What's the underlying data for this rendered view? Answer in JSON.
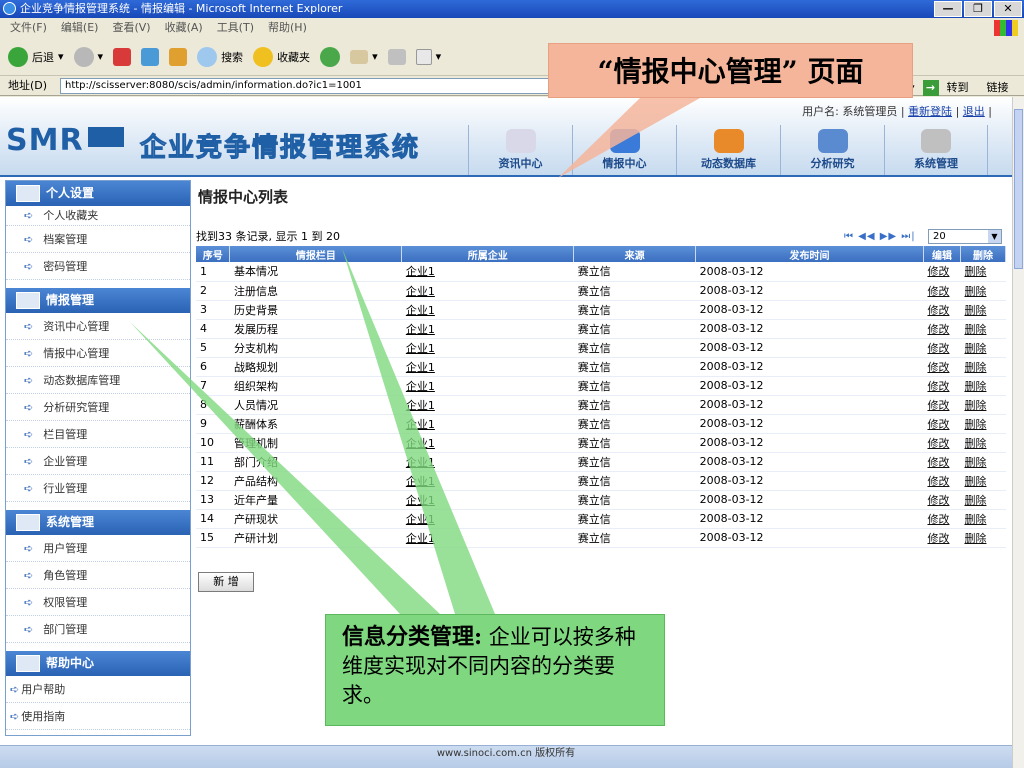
{
  "window": {
    "title": "企业竞争情报管理系统 - 情报编辑 - Microsoft Internet Explorer",
    "buttons": [
      "—",
      "❐",
      "✕"
    ]
  },
  "menubar": [
    "文件(F)",
    "编辑(E)",
    "查看(V)",
    "收藏(A)",
    "工具(T)",
    "帮助(H)"
  ],
  "toolbar": {
    "back": "后退",
    "search": "搜索",
    "favorites": "收藏夹"
  },
  "addressbar": {
    "label": "地址(D)",
    "url": "http://scisserver:8080/scis/admin/information.do?ic1=1001",
    "go": "转到",
    "links": "链接"
  },
  "callout_top": "“情报中心管理” 页面",
  "header": {
    "logo": "SMR",
    "system_title": "企业竞争情报管理系统",
    "user_prefix": "用户名: 系统管理员 |",
    "relogin": "重新登陆",
    "sep": "|",
    "logout": "退出",
    "sep2": "|",
    "nav": [
      "资讯中心",
      "情报中心",
      "动态数据库",
      "分析研究",
      "系统管理"
    ]
  },
  "sidebar": {
    "sections": [
      {
        "title": "个人设置",
        "items": [
          "个人收藏夹",
          "档案管理",
          "密码管理"
        ]
      },
      {
        "title": "情报管理",
        "items": [
          "资讯中心管理",
          "情报中心管理",
          "动态数据库管理",
          "分析研究管理",
          "栏目管理",
          "企业管理",
          "行业管理"
        ]
      },
      {
        "title": "系统管理",
        "items": [
          "用户管理",
          "角色管理",
          "权限管理",
          "部门管理"
        ]
      },
      {
        "title": "帮助中心",
        "items": [
          "用户帮助",
          "使用指南"
        ]
      }
    ]
  },
  "main": {
    "title": "情报中心列表",
    "result_text": "找到33 条记录, 显示 1 到 20",
    "pager": "⏮ ◀◀ ▶▶ ⏭|",
    "page_size": "20",
    "columns": [
      "序号",
      "情报栏目",
      "所属企业",
      "来源",
      "发布时间",
      "编辑",
      "删除"
    ],
    "rows": [
      [
        "1",
        "基本情况",
        "企业1",
        "赛立信",
        "2008-03-12",
        "修改",
        "删除"
      ],
      [
        "2",
        "注册信息",
        "企业1",
        "赛立信",
        "2008-03-12",
        "修改",
        "删除"
      ],
      [
        "3",
        "历史背景",
        "企业1",
        "赛立信",
        "2008-03-12",
        "修改",
        "删除"
      ],
      [
        "4",
        "发展历程",
        "企业1",
        "赛立信",
        "2008-03-12",
        "修改",
        "删除"
      ],
      [
        "5",
        "分支机构",
        "企业1",
        "赛立信",
        "2008-03-12",
        "修改",
        "删除"
      ],
      [
        "6",
        "战略规划",
        "企业1",
        "赛立信",
        "2008-03-12",
        "修改",
        "删除"
      ],
      [
        "7",
        "组织架构",
        "企业1",
        "赛立信",
        "2008-03-12",
        "修改",
        "删除"
      ],
      [
        "8",
        "人员情况",
        "企业1",
        "赛立信",
        "2008-03-12",
        "修改",
        "删除"
      ],
      [
        "9",
        "薪酬体系",
        "企业1",
        "赛立信",
        "2008-03-12",
        "修改",
        "删除"
      ],
      [
        "10",
        "管理机制",
        "企业1",
        "赛立信",
        "2008-03-12",
        "修改",
        "删除"
      ],
      [
        "11",
        "部门介绍",
        "企业1",
        "赛立信",
        "2008-03-12",
        "修改",
        "删除"
      ],
      [
        "12",
        "产品结构",
        "企业1",
        "赛立信",
        "2008-03-12",
        "修改",
        "删除"
      ],
      [
        "13",
        "近年产量",
        "企业1",
        "赛立信",
        "2008-03-12",
        "修改",
        "删除"
      ],
      [
        "14",
        "产研现状",
        "企业1",
        "赛立信",
        "2008-03-12",
        "修改",
        "删除"
      ],
      [
        "15",
        "产研计划",
        "企业1",
        "赛立信",
        "2008-03-12",
        "修改",
        "删除"
      ]
    ],
    "add_button": "新 增"
  },
  "footer": "www.sinoci.com.cn 版权所有",
  "callout_bottom": {
    "bold": "信息分类管理:",
    "text": " 企业可以按多种维度实现对不同内容的分类要求。"
  },
  "colors": {
    "header_blue": "#2a62b4",
    "callout_top_bg": "#f5b59b",
    "callout_bottom_bg": "#7fd87f"
  }
}
